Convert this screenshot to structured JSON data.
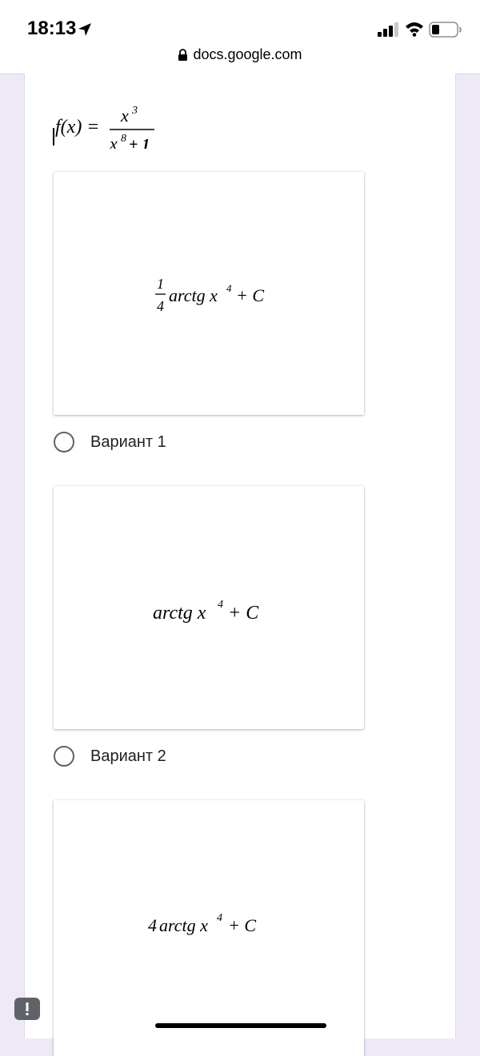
{
  "status_bar": {
    "time": "18:13",
    "icons": [
      "location-arrow-icon",
      "signal-icon",
      "wifi-icon",
      "battery-icon"
    ]
  },
  "browser": {
    "url": "docs.google.com",
    "url_icon": "lock-icon"
  },
  "question": {
    "formula": {
      "lhs": "f(x) =",
      "numerator_base": "x",
      "numerator_exp": "3",
      "denominator_base": "x",
      "denominator_exp": "8",
      "denominator_tail": "+ 1"
    }
  },
  "options": [
    {
      "label": "Вариант 1",
      "formula": {
        "coef_num": "1",
        "coef_den": "4",
        "func": "arctg x",
        "exp": "4",
        "tail": "+ C"
      }
    },
    {
      "label": "Вариант 2",
      "formula": {
        "func": "arctg x",
        "exp": "4",
        "tail": "+ C"
      }
    },
    {
      "label": "",
      "formula": {
        "coef": "4",
        "func": "arctg x",
        "exp": "4",
        "tail": "+ C"
      }
    }
  ],
  "colors": {
    "page_background": "#efe9f7",
    "card_background": "#ffffff",
    "radio_border": "#5f6368",
    "text": "#202124"
  }
}
